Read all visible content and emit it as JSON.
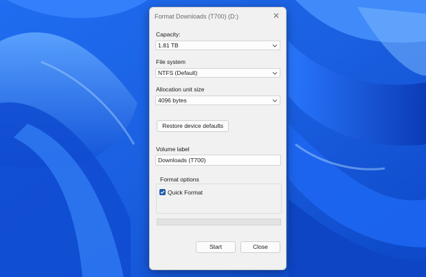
{
  "dialog": {
    "title": "Format Downloads (T700) (D:)",
    "capacity_label": "Capacity:",
    "capacity_value": "1.81 TB",
    "filesystem_label": "File system",
    "filesystem_value": "NTFS (Default)",
    "allocation_label": "Allocation unit size",
    "allocation_value": "4096 bytes",
    "restore_button": "Restore device defaults",
    "volume_label_label": "Volume label",
    "volume_label_value": "Downloads (T700)",
    "format_options_label": "Format options",
    "quick_format_label": "Quick Format",
    "quick_format_checked": true,
    "progress": 0,
    "start_button": "Start",
    "close_button": "Close"
  },
  "icons": {
    "close": "close-icon",
    "dropdown": "chevron-down-icon",
    "check": "checkmark-icon"
  },
  "colors": {
    "wallpaper_light": "#3d8cff",
    "wallpaper_dark": "#0a3fc2",
    "dialog_bg": "#f1f1f1",
    "accent": "#1e5aa8"
  }
}
